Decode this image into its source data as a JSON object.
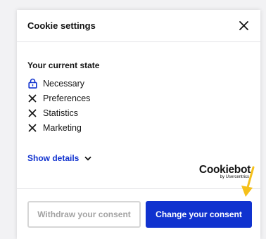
{
  "header": {
    "title": "Cookie settings"
  },
  "state": {
    "title": "Your current state",
    "items": [
      {
        "label": "Necessary",
        "icon": "lock-icon"
      },
      {
        "label": "Preferences",
        "icon": "cross-icon"
      },
      {
        "label": "Statistics",
        "icon": "cross-icon"
      },
      {
        "label": "Marketing",
        "icon": "cross-icon"
      }
    ]
  },
  "show_details": {
    "label": "Show details"
  },
  "logo": {
    "name": "Cookiebot",
    "tagline": "by Usercentrics"
  },
  "footer": {
    "withdraw_label": "Withdraw your consent",
    "change_label": "Change your consent"
  },
  "colors": {
    "accent": "#1032cf",
    "arrow": "#f5c01a",
    "text": "#141414"
  }
}
